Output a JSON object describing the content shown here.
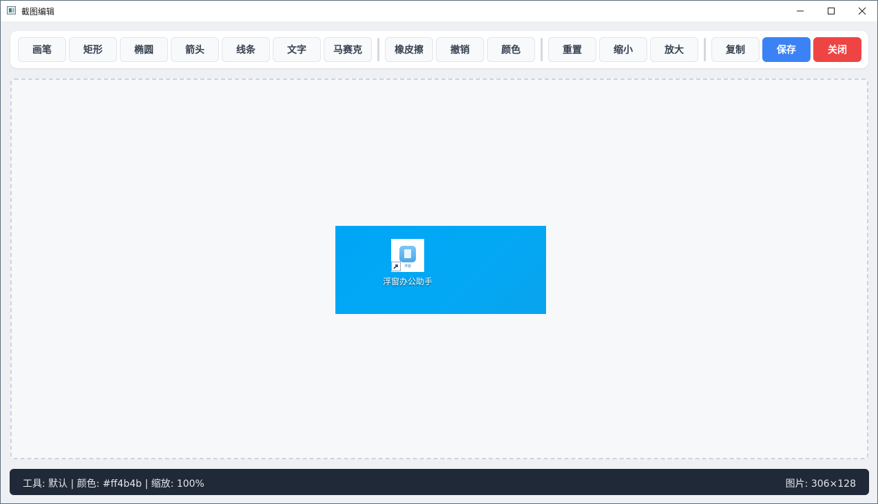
{
  "window": {
    "title": "截图编辑"
  },
  "toolbar": {
    "draw_tools": [
      "画笔",
      "矩形",
      "椭圆",
      "箭头",
      "线条",
      "文字",
      "马赛克"
    ],
    "edit_tools": [
      "橡皮擦",
      "撤销",
      "颜色"
    ],
    "view_tools": [
      "重置",
      "缩小",
      "放大"
    ],
    "copy_label": "复制",
    "save_label": "保存",
    "close_label": "关闭"
  },
  "canvas": {
    "image": {
      "shortcut_label": "浮窗办公助手",
      "icon_caption": "浮窗",
      "background_color": "#03a8f4"
    }
  },
  "status": {
    "left": "工具: 默认 | 颜色: #ff4b4b | 缩放: 100%",
    "right": "图片: 306×128"
  },
  "colors": {
    "accent": "#3b82f6",
    "danger": "#ef4444",
    "statusbar": "#1f2937",
    "current_pen": "#ff4b4b"
  }
}
